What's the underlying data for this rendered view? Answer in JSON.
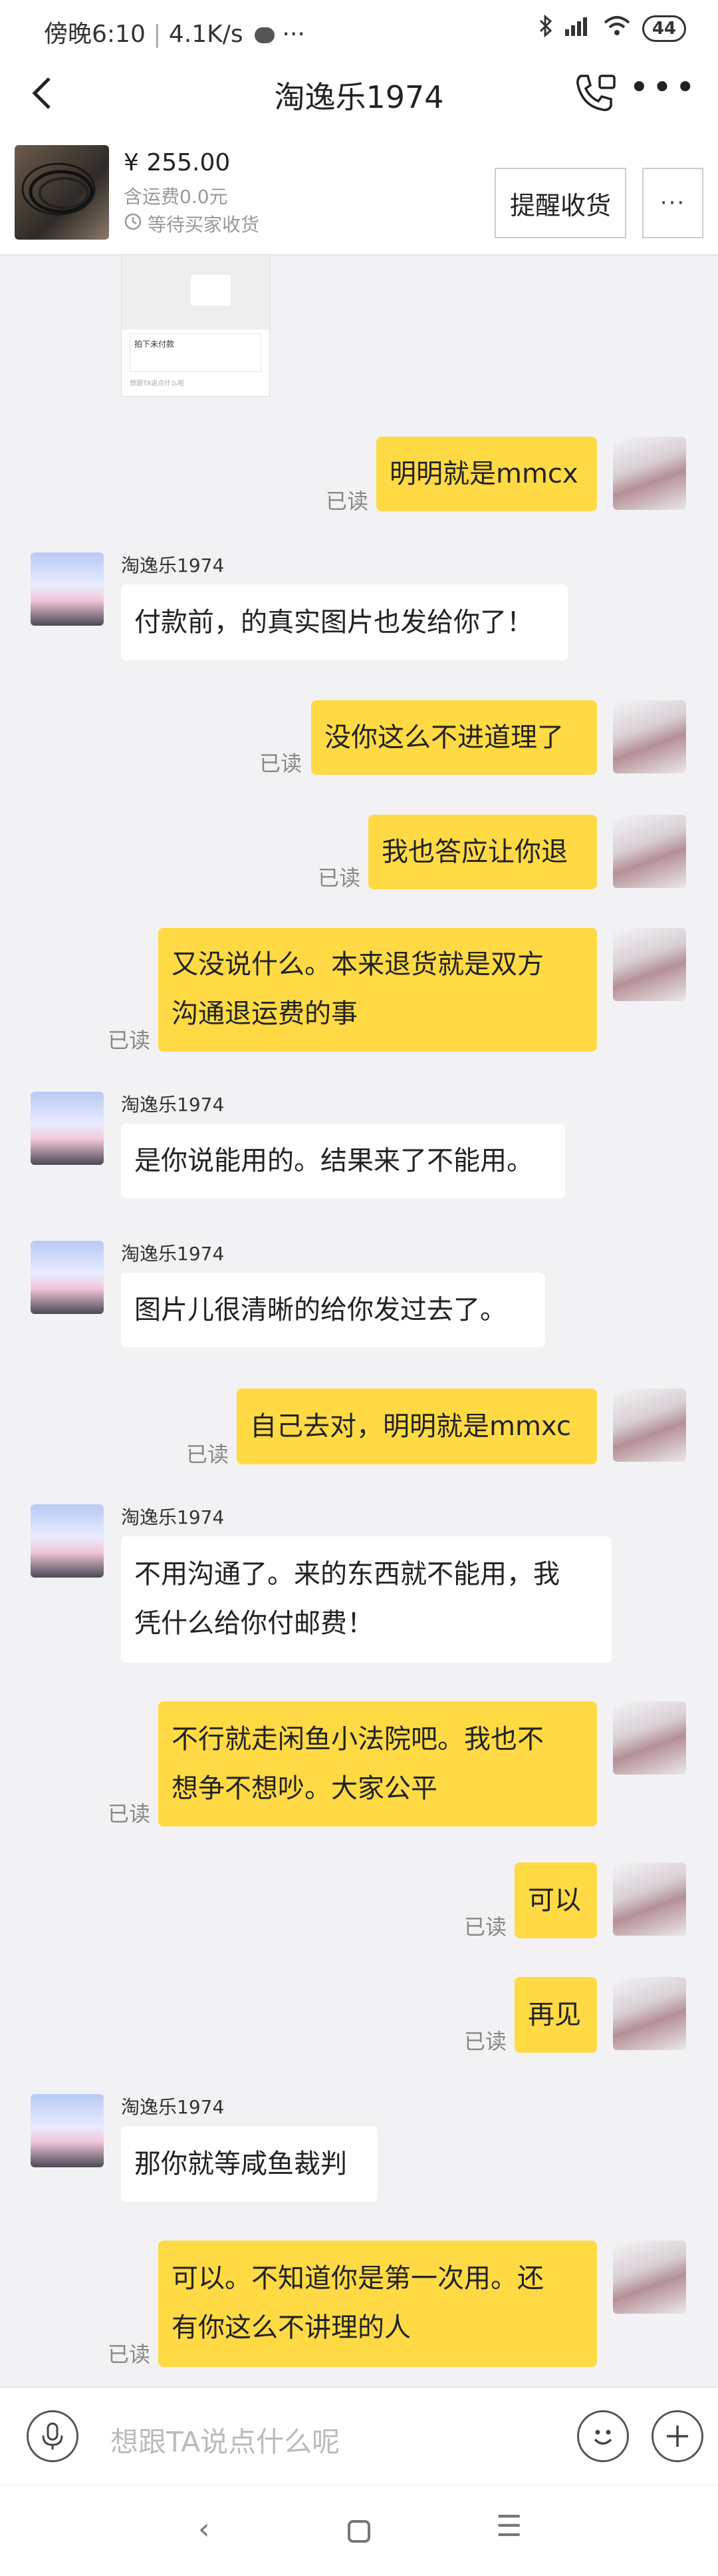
{
  "status_bar": {
    "time": "傍晚6:10",
    "speed": "4.1K/s",
    "wechat_icon": "wechat-icon",
    "more": "···",
    "battery": "44"
  },
  "header": {
    "title": "淘逸乐1974"
  },
  "product": {
    "price": "¥ 255.00",
    "shipping": "含运费0.0元",
    "status": "等待买家收货",
    "remind_button": "提醒收货",
    "more_button": "···"
  },
  "screenshot_preview": {
    "label": "拍下未付款",
    "input_hint": "想跟TA说点什么呢"
  },
  "messages": [
    {
      "side": "me",
      "text": "明明就是mmcx",
      "read": "已读"
    },
    {
      "side": "other",
      "sender": "淘逸乐1974",
      "text": "付款前，的真实图片也发给你了！"
    },
    {
      "side": "me",
      "text": "没你这么不进道理了",
      "read": "已读"
    },
    {
      "side": "me",
      "text": "我也答应让你退",
      "read": "已读"
    },
    {
      "side": "me",
      "lines": [
        "又没说什么。本来退货就是双方",
        "沟通退运费的事"
      ],
      "read": "已读"
    },
    {
      "side": "other",
      "sender": "淘逸乐1974",
      "text": "是你说能用的。结果来了不能用。"
    },
    {
      "side": "other",
      "sender": "淘逸乐1974",
      "text": "图片儿很清晰的给你发过去了。"
    },
    {
      "side": "me",
      "text": "自己去对，明明就是mmxc",
      "read": "已读"
    },
    {
      "side": "other",
      "sender": "淘逸乐1974",
      "lines": [
        "不用沟通了。来的东西就不能用，我",
        "凭什么给你付邮费！"
      ]
    },
    {
      "side": "me",
      "lines": [
        "不行就走闲鱼小法院吧。我也不",
        "想争不想吵。大家公平"
      ],
      "read": "已读"
    },
    {
      "side": "me",
      "text": "可以",
      "read": "已读"
    },
    {
      "side": "me",
      "text": "再见",
      "read": "已读"
    },
    {
      "side": "other",
      "sender": "淘逸乐1974",
      "text": "那你就等咸鱼裁判"
    },
    {
      "side": "me",
      "lines": [
        "可以。不知道你是第一次用。还",
        "有你这么不讲理的人"
      ],
      "read": "已读"
    }
  ],
  "input": {
    "placeholder": "想跟TA说点什么呢"
  },
  "nav": {
    "back": "‹",
    "menu": "☰"
  }
}
